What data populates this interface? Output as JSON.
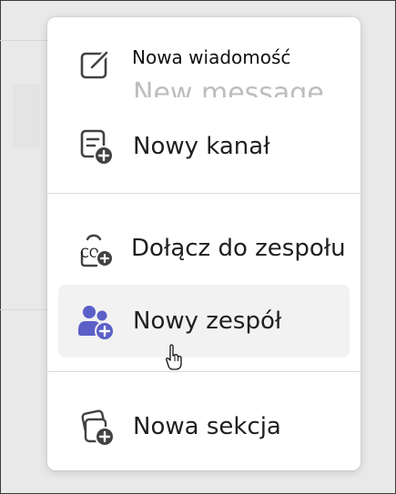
{
  "menu": {
    "items": [
      {
        "label": "Nowa wiadomość",
        "ghost": "New message",
        "icon": "compose-icon"
      },
      {
        "label": "Nowy kanał",
        "icon": "channel-add-icon"
      },
      {
        "label": "Dołącz do zespołu",
        "icon": "join-team-code-icon",
        "code_text": "CO"
      },
      {
        "label": "Nowy zespół",
        "icon": "team-add-icon"
      },
      {
        "label": "Nowa sekcja",
        "icon": "section-add-icon"
      }
    ]
  },
  "colors": {
    "accent": "#5b5fc7",
    "icon": "#424242",
    "hover_bg": "#f2f2f2"
  }
}
